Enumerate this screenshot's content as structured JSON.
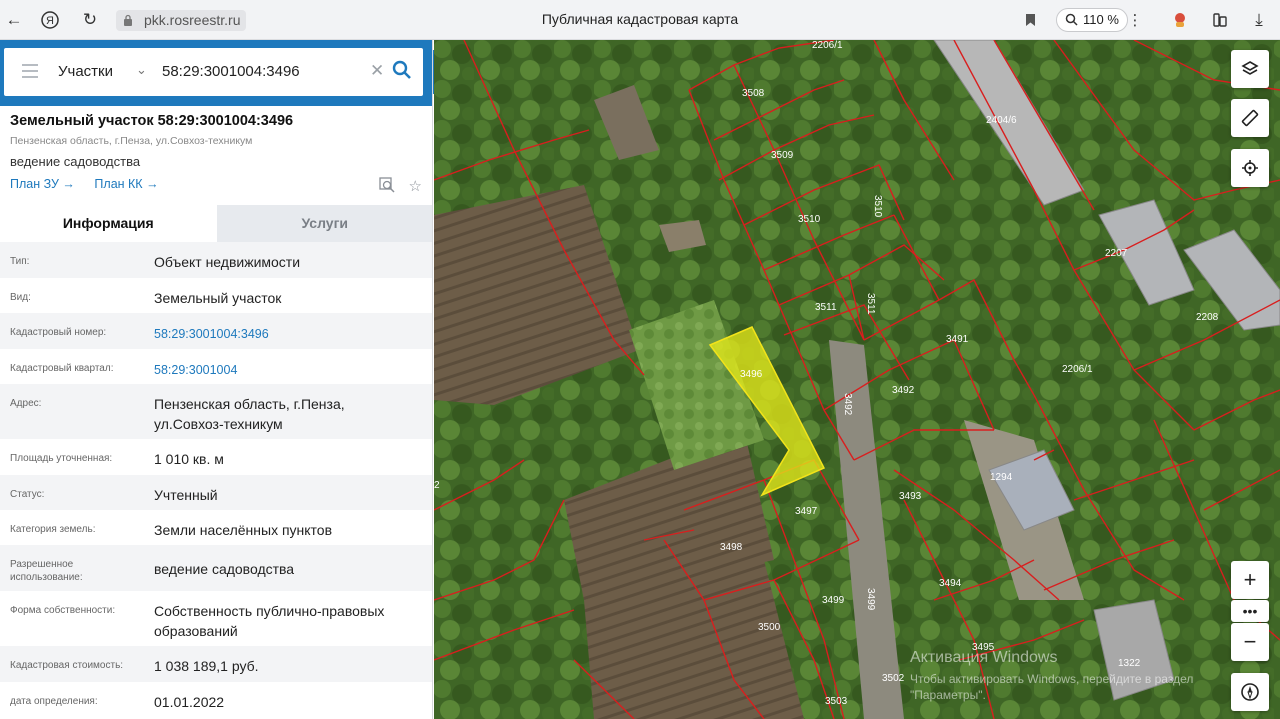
{
  "browser": {
    "url": "pkk.rosreestr.ru",
    "title": "Публичная кадастровая карта",
    "zoom": "110 %"
  },
  "search": {
    "type": "Участки",
    "query": "58:29:3001004:3496"
  },
  "parcel": {
    "title": "Земельный участок 58:29:3001004:3496",
    "address": "Пензенская область, г.Пенза, ул.Совхоз-техникум",
    "usage": "ведение садоводства",
    "plan_zu": "План ЗУ →",
    "plan_kk": "План КК →"
  },
  "tabs": {
    "info": "Информация",
    "services": "Услуги"
  },
  "details": [
    {
      "key": "Тип:",
      "value": "Объект недвижимости"
    },
    {
      "key": "Вид:",
      "value": "Земельный участок"
    },
    {
      "key": "Кадастровый номер:",
      "value": "58:29:3001004:3496"
    },
    {
      "key": "Кадастровый квартал:",
      "value": "58:29:3001004"
    },
    {
      "key": "Адрес:",
      "value": "Пензенская область, г.Пенза, ул.Совхоз-техникум"
    },
    {
      "key": "Площадь уточненная:",
      "value": "1 010 кв. м"
    },
    {
      "key": "Статус:",
      "value": "Учтенный"
    },
    {
      "key": "Категория земель:",
      "value": "Земли населённых пунктов"
    },
    {
      "key": "Разрешенное использование:",
      "value": "ведение садоводства"
    },
    {
      "key": "Форма собственности:",
      "value": "Собственность публично-правовых образований"
    },
    {
      "key": "Кадастровая стоимость:",
      "value": "1 038 189,1 руб."
    },
    {
      "key": "дата определения:",
      "value": "01.01.2022"
    }
  ],
  "map": {
    "parcel_labels": [
      "2206/1",
      "3508",
      "3509",
      "3510",
      "3510",
      "2404/6",
      "2207",
      "2208",
      "3511",
      "3511",
      "3491",
      "2206/1",
      "3496",
      "3492",
      "3492",
      "1294",
      "3493",
      "3497",
      "3498",
      "3494",
      "3499",
      "3499",
      "3500",
      "3495",
      "1322",
      "3502",
      "3503",
      "2"
    ],
    "watermark_title": "Активация Windows",
    "watermark_text": "Чтобы активировать Windows, перейдите в раздел \"Параметры\"."
  }
}
